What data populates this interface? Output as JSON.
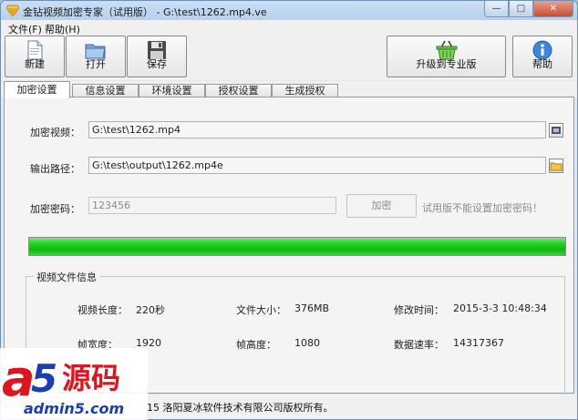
{
  "window": {
    "title": "金钻视频加密专家（试用版） - G:\\test\\1262.mp4.ve",
    "min_symbol": "—",
    "max_symbol": "□",
    "close_symbol": "✕"
  },
  "menu": [
    "文件(F)",
    "帮助(H)"
  ],
  "toolbar": {
    "new_label": "新建",
    "open_label": "打开",
    "save_label": "保存",
    "upgrade_label": "升级到专业版",
    "help_label": "帮助"
  },
  "tabs": [
    "加密设置",
    "信息设置",
    "环境设置",
    "授权设置",
    "生成授权"
  ],
  "form": {
    "video_label": "加密视频：",
    "video_value": "G:\\test\\1262.mp4",
    "output_label": "输出路径：",
    "output_value": "G:\\test\\output\\1262.mp4e",
    "password_label": "加密密码：",
    "password_value": "123456",
    "encrypt_label": "加密",
    "hint": "试用版不能设置加密密码！"
  },
  "progress": 1.0,
  "info": {
    "group_title": "视频文件信息",
    "duration_label": "视频长度：",
    "duration_value": "220秒",
    "size_label": "文件大小：",
    "size_value": "376MB",
    "mtime_label": "修改时间：",
    "mtime_value": "2015-3-3 10:48:34",
    "width_label": "帧宽度：",
    "width_value": "1920",
    "height_label": "帧高度：",
    "height_value": "1080",
    "rate_label": "数据速率：",
    "rate_value": "14317367"
  },
  "status": "15 洛阳夏冰软件技术有限公司版权所有。",
  "watermark": {
    "logo_a": "a",
    "logo_5": "5",
    "logo_cn": "源码",
    "url": "admin5.com"
  },
  "colors": {
    "progress_green": "#1ed21e",
    "watermark_red": "#e0141e",
    "watermark_blue": "#1a3fb0"
  }
}
